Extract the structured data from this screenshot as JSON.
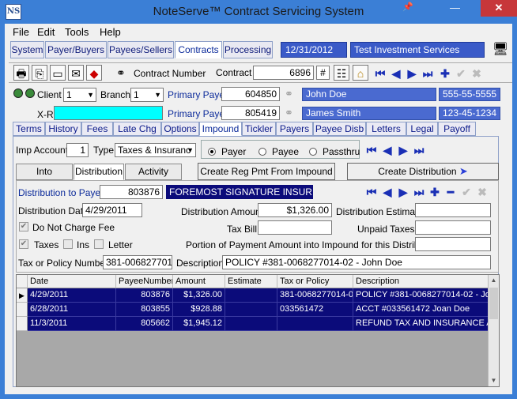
{
  "window": {
    "title": "NoteServe™ Contract Servicing System",
    "logo": "NS",
    "pin_icon": "📌",
    "minimize": "—",
    "maximize": "☐",
    "close": "✕"
  },
  "menu": [
    "File",
    "Edit",
    "Tools",
    "Help"
  ],
  "top_tabs": [
    "System",
    "Payer/Buyers",
    "Payees/Sellers",
    "Contracts",
    "Processing"
  ],
  "top_tabs_active": "Contracts",
  "date": "12/31/2012",
  "company": "Test Investment Services",
  "toolbar": {
    "contract_number_label": "Contract Number",
    "contract_label": "Contract",
    "contract_value": "6896",
    "hash_label": "#"
  },
  "client": {
    "client_label": "Client",
    "client_value": "1",
    "branch_label": "Branch",
    "branch_value": "1",
    "primary_payer_label": "Primary Payer",
    "primary_payer_id": "604850",
    "primary_payer_name": "John Doe",
    "primary_payer_phone": "555-55-5555",
    "xref_label": "X-Ref",
    "primary_payee_label": "Primary Payee",
    "primary_payee_id": "805419",
    "primary_payee_name": "James Smith",
    "primary_payee_ssn": "123-45-1234"
  },
  "contract_tabs": [
    "Terms",
    "History",
    "Fees",
    "Late Chg",
    "Options",
    "Impound",
    "Tickler",
    "Payers",
    "Payee Disb",
    "Letters",
    "Legal",
    "Payoff"
  ],
  "contract_tabs_active": "Impound",
  "impound": {
    "imp_account_label": "Imp Account",
    "imp_account_value": "1",
    "type_label": "Type",
    "type_value": "Taxes & Insuranc",
    "radio_payer": "Payer",
    "radio_payee": "Payee",
    "radio_passthru": "Passthru",
    "radio_selected": "Payer"
  },
  "sub_tabs": [
    "Into Impound",
    "Distribution",
    "Activity Detail"
  ],
  "sub_tabs_active": "Distribution",
  "buttons": {
    "create_reg_pmt": "Create Reg Pmt From Impound",
    "create_distribution": "Create Distribution"
  },
  "distribution": {
    "to_payee_label": "Distribution to Payee",
    "payee_id": "803876",
    "payee_name": "FOREMOST SIGNATURE INSURANC",
    "date_label": "Distribution Date",
    "date_value": "4/29/2011",
    "amount_label": "Distribution Amount",
    "amount_value": "$1,326.00",
    "estimate_label": "Distribution Estimate",
    "estimate_value": "",
    "do_not_charge_fee": "Do Not Charge Fee",
    "tax_bill_label": "Tax Bill",
    "tax_bill_value": "",
    "unpaid_taxes_label": "Unpaid Taxes",
    "unpaid_taxes_value": "",
    "taxes_label": "Taxes",
    "ins_label": "Ins",
    "letter_label": "Letter",
    "portion_label": "Portion of Payment Amount into Impound for this Distribution",
    "portion_value": "",
    "tax_policy_label": "Tax or Policy Number",
    "tax_policy_value": "381-0068277014-",
    "description_label": "Description",
    "description_value": "POLICY #381-0068277014-02 - John Doe"
  },
  "grid": {
    "columns": [
      "Date",
      "PayeeNumber",
      "Amount",
      "Estimate",
      "Tax or Policy",
      "Description"
    ],
    "rows": [
      {
        "date": "4/29/2011",
        "payee": "803876",
        "amount": "$1,326.00",
        "estimate": "",
        "policy": "381-0068277014-02",
        "description": "POLICY #381-0068277014-02 - Joh"
      },
      {
        "date": "6/28/2011",
        "payee": "803855",
        "amount": "$928.88",
        "estimate": "",
        "policy": "033561472",
        "description": "ACCT #033561472 Joan Doe"
      },
      {
        "date": "11/3/2011",
        "payee": "805662",
        "amount": "$1,945.12",
        "estimate": "",
        "policy": "",
        "description": "REFUND TAX AND INSURANCE A"
      }
    ]
  }
}
